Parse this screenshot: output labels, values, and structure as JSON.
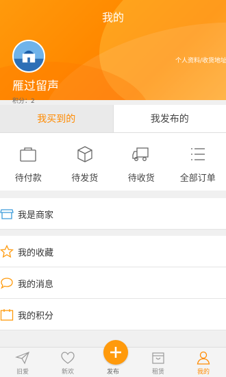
{
  "header": {
    "title": "我的",
    "username": "雁过留声",
    "profile_link": "个人资料/收货地址",
    "points": "积分：2"
  },
  "tabs": [
    {
      "label": "我买到的",
      "active": true
    },
    {
      "label": "我发布的",
      "active": false
    }
  ],
  "orders": [
    {
      "label": "待付款",
      "icon": "wallet-icon"
    },
    {
      "label": "待发货",
      "icon": "box-icon"
    },
    {
      "label": "待收货",
      "icon": "truck-icon"
    },
    {
      "label": "全部订单",
      "icon": "list-icon"
    }
  ],
  "menu": [
    {
      "label": "我是商家",
      "icon": "store-icon"
    },
    {
      "label": "我的收藏",
      "icon": "star-icon"
    },
    {
      "label": "我的消息",
      "icon": "chat-icon"
    },
    {
      "label": "我的积分",
      "icon": "calendar-icon"
    }
  ],
  "nav": [
    {
      "label": "旧爱",
      "icon": "plane-icon"
    },
    {
      "label": "新欢",
      "icon": "heart-icon"
    },
    {
      "label": "发布",
      "icon": "plus-icon"
    },
    {
      "label": "租赁",
      "icon": "bag-icon"
    },
    {
      "label": "我的",
      "icon": "user-icon",
      "active": true
    }
  ],
  "colors": {
    "accent": "#ff8a00",
    "icon_blue": "#3a9ad9"
  }
}
